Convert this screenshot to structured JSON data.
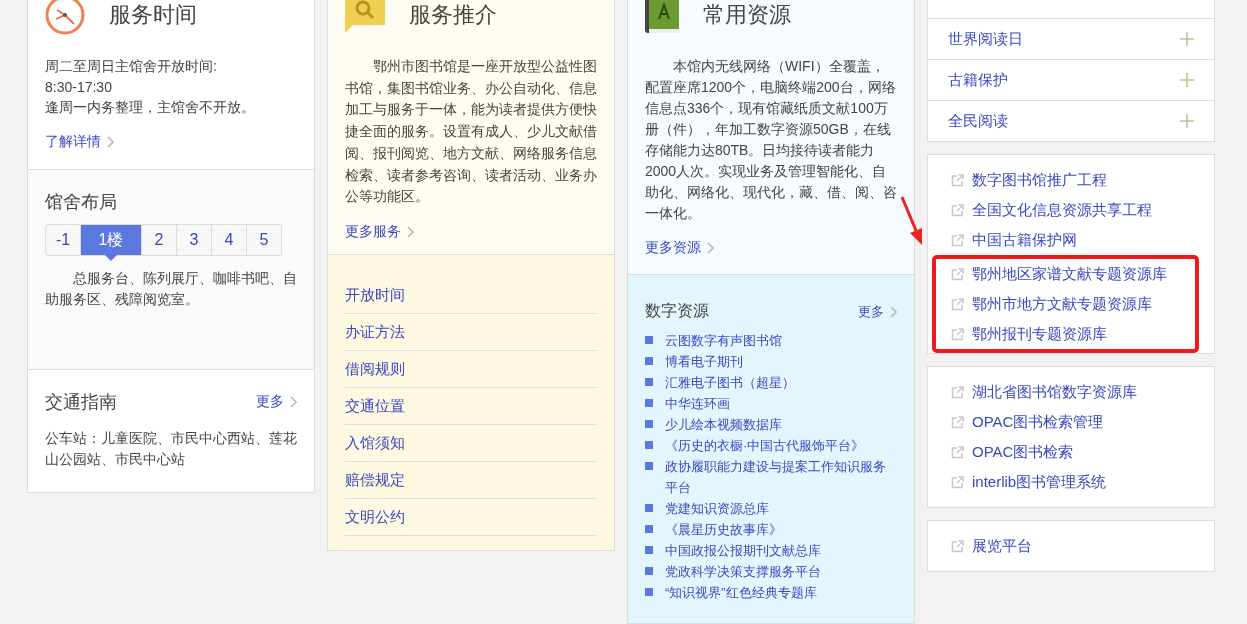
{
  "hours": {
    "title": "服务时间",
    "lines": [
      "周二至周日主馆舍开放时间:",
      "8:30-17:30",
      "逢周一内务整理，主馆舍不开放。"
    ],
    "more": "了解详情"
  },
  "layout": {
    "title": "馆舍布局",
    "floors": [
      {
        "label": "-1",
        "selected": false
      },
      {
        "label": "1楼",
        "selected": true
      },
      {
        "label": "2",
        "selected": false
      },
      {
        "label": "3",
        "selected": false
      },
      {
        "label": "4",
        "selected": false
      },
      {
        "label": "5",
        "selected": false
      }
    ],
    "description": "总服务台、陈列展厅、咖啡书吧、自助服务区、残障阅览室。"
  },
  "traffic": {
    "title": "交通指南",
    "more": "更多",
    "text": "公车站：儿童医院、市民中心西站、莲花山公园站、市民中心站"
  },
  "services": {
    "title": "服务推介",
    "text": "鄂州市图书馆是一座开放型公益性图书馆，集图书馆业务、办公自动化、信息加工与服务于一体，能为读者提供方便快捷全面的服务。设置有成人、少儿文献借阅、报刊阅览、地方文献、网络服务信息检索、读者参考咨询、读者活动、业务办公等功能区。",
    "more": "更多服务",
    "links": [
      "开放时间",
      "办证方法",
      "借阅规则",
      "交通位置",
      "入馆须知",
      "赔偿规定",
      "文明公约"
    ]
  },
  "resources": {
    "title": "常用资源",
    "text": "本馆内无线网络（WIFI）全覆盖，配置座席1200个，电脑终端200台，网络信息点336个，现有馆藏纸质文献100万册（件），年加工数字资源50GB，在线存储能力达80TB。日均接待读者能力2000人次。实现业务及管理智能化、自助化、网络化、现代化，藏、借、阅、咨一体化。",
    "more": "更多资源"
  },
  "digital": {
    "title": "数字资源",
    "more": "更多",
    "items": [
      "云图数字有声图书馆",
      "博看电子期刊",
      "汇雅电子图书（超星）",
      "中华连环画",
      "少儿绘本视频数据库",
      "《历史的衣橱·中国古代服饰平台》",
      "政协履职能力建设与提案工作知识服务平台",
      "党建知识资源总库",
      "《晨星历史故事库》",
      "中国政报公报期刊文献总库",
      "党政科学决策支撑服务平台",
      "“知识视界”红色经典专题库"
    ]
  },
  "topics": [
    "世界阅读日",
    "古籍保护",
    "全民阅读"
  ],
  "link_cards": [
    {
      "groups": [
        {
          "highlighted": false,
          "items": [
            "数字图书馆推广工程",
            "全国文化信息资源共享工程",
            "中国古籍保护网"
          ]
        },
        {
          "highlighted": true,
          "items": [
            "鄂州地区家谱文献专题资源库",
            "鄂州市地方文献专题资源库",
            "鄂州报刊专题资源库"
          ]
        }
      ]
    },
    {
      "groups": [
        {
          "highlighted": false,
          "items": [
            "湖北省图书馆数字资源库",
            "OPAC图书检索管理",
            "OPAC图书检索",
            "interlib图书管理系统"
          ]
        }
      ]
    },
    {
      "groups": [
        {
          "highlighted": false,
          "items": [
            "展览平台"
          ]
        }
      ]
    }
  ]
}
